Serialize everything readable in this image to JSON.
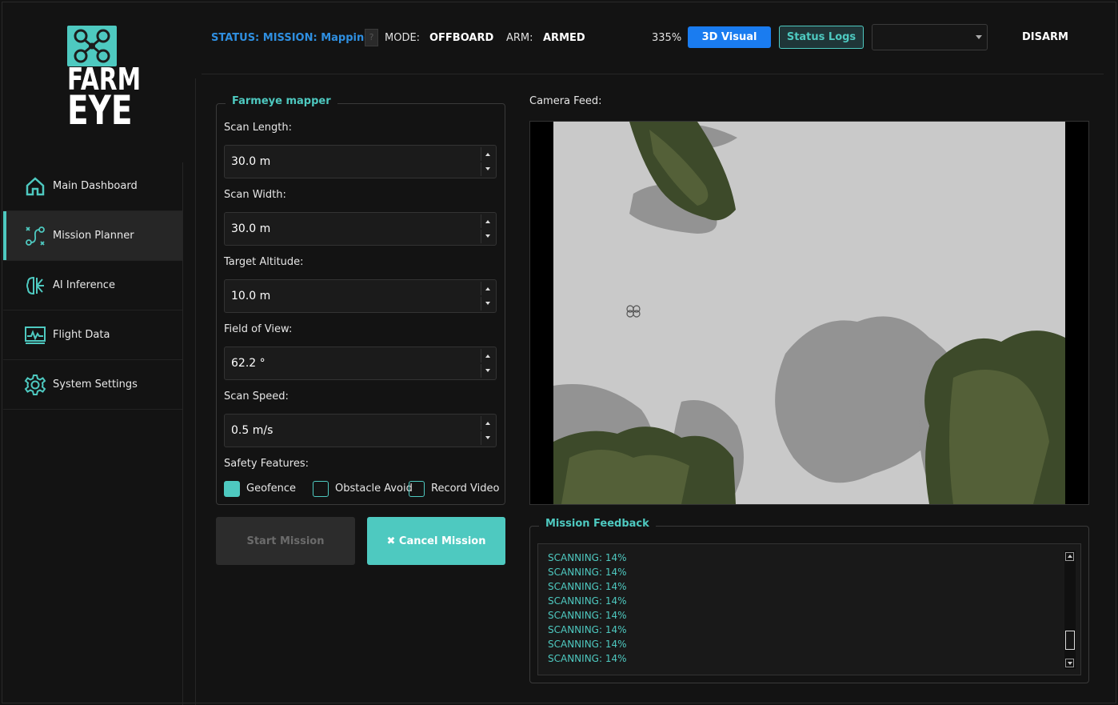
{
  "brand": {
    "line1": "FARM",
    "line2": "EYE",
    "accent": "#4ec9c0"
  },
  "sidebar": {
    "items": [
      {
        "label": "Main Dashboard",
        "icon": "home-icon",
        "active": false
      },
      {
        "label": "Mission Planner",
        "icon": "route-icon",
        "active": true
      },
      {
        "label": "AI Inference",
        "icon": "brain-icon",
        "active": false
      },
      {
        "label": "Flight Data",
        "icon": "chart-monitor-icon",
        "active": false
      },
      {
        "label": "System Settings",
        "icon": "gear-icon",
        "active": false
      }
    ]
  },
  "header": {
    "status": "STATUS: MISSION: Mapping",
    "help": "?",
    "mode_label": "MODE:",
    "mode_value": "OFFBOARD",
    "arm_label": "ARM:",
    "arm_value": "ARMED",
    "battery": "335%",
    "visual_button": "3D Visual",
    "logs_button": "Status Logs",
    "select_value": "",
    "disarm_button": "DISARM"
  },
  "mapper": {
    "title": "Farmeye mapper",
    "fields": [
      {
        "label": "Scan Length:",
        "value": "30.0 m"
      },
      {
        "label": "Scan Width:",
        "value": "30.0 m"
      },
      {
        "label": "Target Altitude:",
        "value": "10.0 m"
      },
      {
        "label": "Field of View:",
        "value": "62.2 °"
      },
      {
        "label": "Scan Speed:",
        "value": "0.5 m/s"
      }
    ],
    "safety_label": "Safety Features:",
    "checks": [
      {
        "label": "Geofence",
        "checked": true
      },
      {
        "label": "Obstacle Avoid",
        "checked": false
      },
      {
        "label": "Record Video",
        "checked": false
      }
    ],
    "start_button": "Start Mission",
    "cancel_button": "✖ Cancel Mission"
  },
  "camera": {
    "label": "Camera Feed:"
  },
  "feedback": {
    "title": "Mission Feedback",
    "lines": [
      "SCANNING: 14%",
      "SCANNING: 14%",
      "SCANNING: 14%",
      "SCANNING: 14%",
      "SCANNING: 14%",
      "SCANNING: 14%",
      "SCANNING: 14%",
      "SCANNING: 14%"
    ]
  },
  "colors": {
    "accent": "#4ec9c0",
    "status_blue": "#2f8fe0",
    "primary_button": "#1a7cf0"
  }
}
